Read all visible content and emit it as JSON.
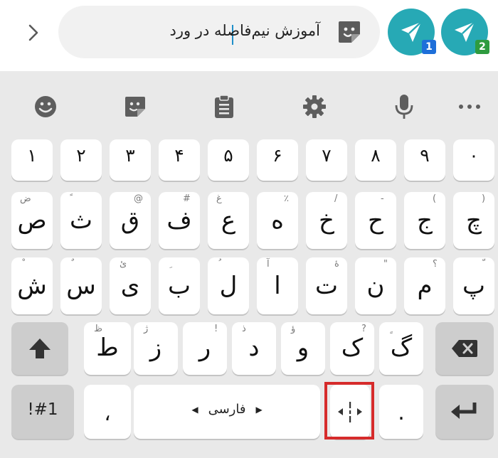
{
  "compose": {
    "text": "آموزش نیم‌فاصله در ورد",
    "send_buttons": [
      {
        "badge": "1"
      },
      {
        "badge": "2"
      }
    ]
  },
  "toolbar": {
    "icons": [
      "emoji-icon",
      "sticker-icon",
      "clipboard-icon",
      "settings-icon",
      "microphone-icon",
      "more-icon"
    ]
  },
  "keyboard": {
    "numbers": [
      "۱",
      "۲",
      "۳",
      "۴",
      "۵",
      "۶",
      "۷",
      "۸",
      "۹",
      "۰"
    ],
    "row2": [
      {
        "main": "ص",
        "hint": "ض"
      },
      {
        "main": "ث",
        "hint": "ً"
      },
      {
        "main": "ق",
        "hint": "@"
      },
      {
        "main": "ف",
        "hint": "#"
      },
      {
        "main": "ع",
        "hint": "غ"
      },
      {
        "main": "ه",
        "hint": "٪"
      },
      {
        "main": "خ",
        "hint": "/"
      },
      {
        "main": "ح",
        "hint": "-"
      },
      {
        "main": "ج",
        "hint": "("
      },
      {
        "main": "چ",
        "hint": ")"
      }
    ],
    "row3": [
      {
        "main": "ش",
        "hint": "ْ"
      },
      {
        "main": "س",
        "hint": "ٌ"
      },
      {
        "main": "ی",
        "hint": "ئ"
      },
      {
        "main": "ب",
        "hint": "ِ"
      },
      {
        "main": "ل",
        "hint": "ُ"
      },
      {
        "main": "ا",
        "hint": "آ"
      },
      {
        "main": "ت",
        "hint": "ۀ"
      },
      {
        "main": "ن",
        "hint": "\""
      },
      {
        "main": "م",
        "hint": "؟"
      },
      {
        "main": "پ",
        "hint": "ّ"
      }
    ],
    "row4": [
      {
        "main": "ط",
        "hint": "ظ"
      },
      {
        "main": "ز",
        "hint": "ژ"
      },
      {
        "main": "ر",
        "hint": "!"
      },
      {
        "main": "د",
        "hint": "ذ"
      },
      {
        "main": "و",
        "hint": "ؤ"
      },
      {
        "main": "ک",
        "hint": "?"
      },
      {
        "main": "گ",
        "hint": "ٍ"
      }
    ],
    "symbols_label": "!#1",
    "comma": "،",
    "space_label": "فارسی",
    "period": "."
  }
}
